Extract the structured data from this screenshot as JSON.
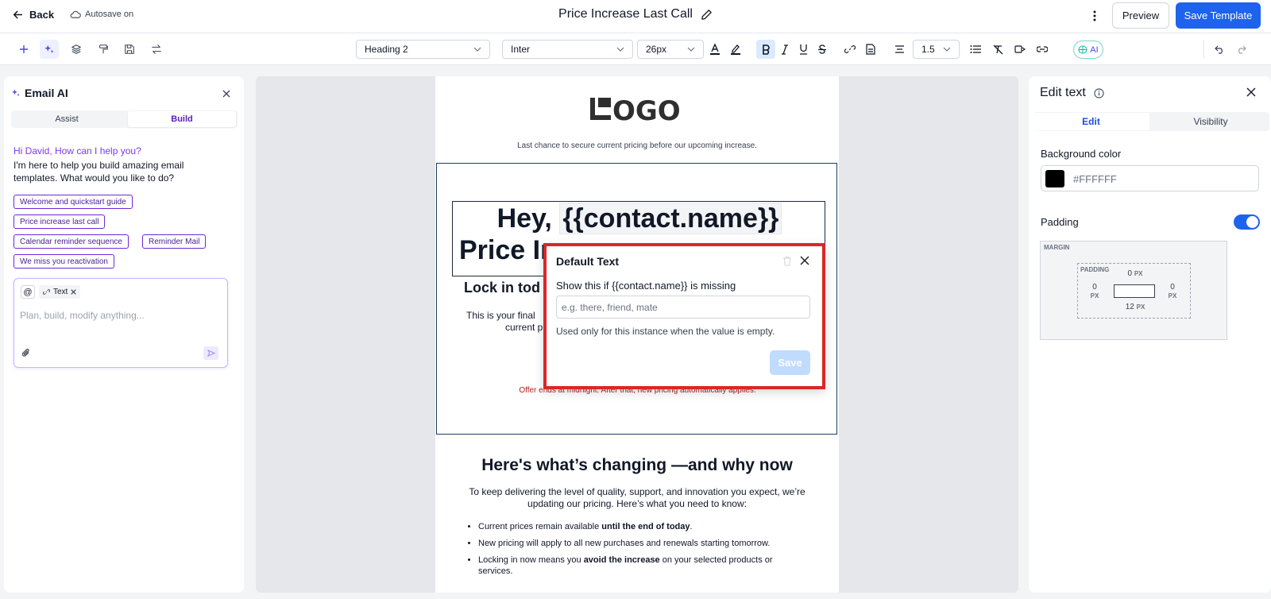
{
  "topbar": {
    "back_label": "Back",
    "autosave_label": "Autosave on",
    "title": "Price Increase Last Call",
    "preview_label": "Preview",
    "save_template_label": "Save Template"
  },
  "toolbar": {
    "block_type": "Heading 2",
    "font_family": "Inter",
    "font_size": "26px",
    "line_height": "1.5",
    "ai_label": "AI"
  },
  "ai_panel": {
    "title": "Email AI",
    "tabs": {
      "assist": "Assist",
      "build": "Build",
      "active": "Build"
    },
    "greeting": "Hi David, How can I help you?",
    "intro": "I'm here to help you build amazing email templates. What would you like to do?",
    "suggestions": [
      "Welcome and quickstart guide",
      "Price increase last call",
      "Calendar reminder sequence",
      "Reminder Mail",
      "We miss you reactivation"
    ],
    "context_tag": "Text",
    "input_placeholder": "Plan, build, modify anything..."
  },
  "email": {
    "logo_text": "OGO",
    "preheader": "Last chance to secure current pricing before our upcoming increase.",
    "headline_prefix": "Hey, ",
    "headline_tag": "{{contact.name}}",
    "headline_line2": "Price In",
    "subheading": "Lock in tod",
    "body_line1": "This is your final",
    "body_line2": "current p",
    "offer_note": "Offer ends at midnight. After that, new pricing automatically applies.",
    "section_heading": "Here's what’s changing —and why now",
    "section_para": "To keep delivering the level of quality, support, and innovation you expect, we’re updating our pricing. Here’s what you need to know:",
    "bullets": [
      {
        "pre": "Current prices remain available ",
        "bold": "until the end of today",
        "post": "."
      },
      {
        "pre": "New pricing will apply to all new purchases and renewals starting tomorrow.",
        "bold": "",
        "post": ""
      },
      {
        "pre": "Locking in now means you ",
        "bold": "avoid the increase",
        "post": " on your selected products or services."
      }
    ]
  },
  "default_text_popup": {
    "title": "Default Text",
    "label": "Show this if {{contact.name}} is missing",
    "placeholder": "e.g. there, friend, mate",
    "help": "Used only for this instance when the value is empty.",
    "save_label": "Save"
  },
  "edit_panel": {
    "title": "Edit text",
    "tabs": {
      "edit": "Edit",
      "visibility": "Visibility",
      "active": "Edit"
    },
    "background_label": "Background color",
    "background_value": "#FFFFFF",
    "swatch_color": "#000000",
    "padding_label": "Padding",
    "padding_enabled": true,
    "box_model": {
      "margin_label": "MARGIN",
      "padding_label": "PADDING",
      "top": "0",
      "left": "0",
      "right": "0",
      "bottom": "12",
      "unit": "PX"
    }
  },
  "colors": {
    "primary": "#1d63ed",
    "ai_purple": "#7c3aed",
    "offer_red": "#b91c1c",
    "highlight": "#dc2626"
  }
}
